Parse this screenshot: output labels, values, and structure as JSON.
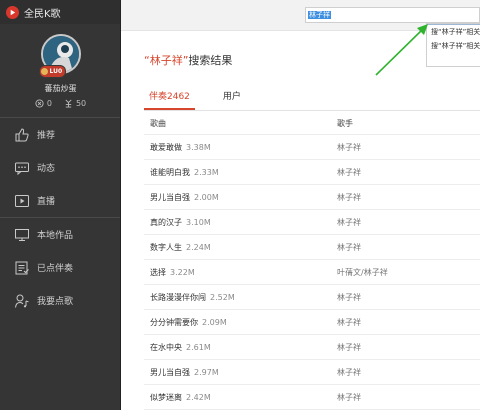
{
  "app": {
    "title": "全民K歌"
  },
  "user": {
    "nickname": "蕃茄炒蛋",
    "level_badge": "LU0",
    "followers": "0",
    "gifts": "50"
  },
  "nav": [
    {
      "label": "推荐",
      "icon": "thumbs-up-icon"
    },
    {
      "label": "动态",
      "icon": "chat-bubble-icon"
    },
    {
      "label": "直播",
      "icon": "video-play-icon"
    },
    {
      "label": "本地作品",
      "icon": "monitor-icon"
    },
    {
      "label": "已点伴奏",
      "icon": "checklist-icon"
    },
    {
      "label": "我要点歌",
      "icon": "person-music-icon"
    }
  ],
  "search": {
    "value": "林子祥",
    "suggestions": [
      "搜“林子祥”相关",
      "搜“林子祥”相关"
    ]
  },
  "results": {
    "keyword_display": "“林子祥”",
    "title_suffix": "搜索结果",
    "tabs": [
      {
        "label": "伴奏2462",
        "active": true
      },
      {
        "label": "用户",
        "active": false
      }
    ],
    "columns": {
      "song": "歌曲",
      "artist": "歌手"
    },
    "rows": [
      {
        "song": "敢爱敢做",
        "size": "3.38M",
        "artist": "林子祥"
      },
      {
        "song": "谁能明白我",
        "size": "2.33M",
        "artist": "林子祥"
      },
      {
        "song": "男儿当自强",
        "size": "2.00M",
        "artist": "林子祥"
      },
      {
        "song": "真的汉子",
        "size": "3.10M",
        "artist": "林子祥"
      },
      {
        "song": "数字人生",
        "size": "2.24M",
        "artist": "林子祥"
      },
      {
        "song": "选择",
        "size": "3.22M",
        "artist": "叶蒨文/林子祥"
      },
      {
        "song": "长路漫漫伴你闯",
        "size": "2.52M",
        "artist": "林子祥"
      },
      {
        "song": "分分钟需要你",
        "size": "2.09M",
        "artist": "林子祥"
      },
      {
        "song": "在水中央",
        "size": "2.61M",
        "artist": "林子祥"
      },
      {
        "song": "男儿当自强",
        "size": "2.97M",
        "artist": "林子祥"
      },
      {
        "song": "似梦迷离",
        "size": "2.42M",
        "artist": "林子祥"
      }
    ]
  },
  "colors": {
    "accent": "#d6452c",
    "sidebar": "#353535",
    "arrow": "#2fb32f"
  }
}
